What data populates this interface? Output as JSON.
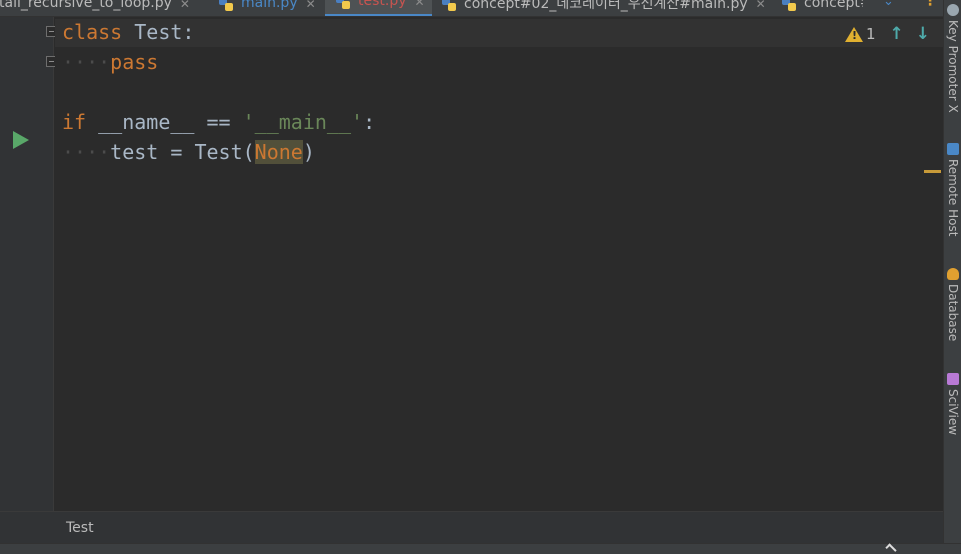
{
  "tabs": [
    {
      "label": "tail_recursive_to_loop.py",
      "color": "#bbbbbb",
      "active": false,
      "closable": true
    },
    {
      "label": "main.py",
      "color": "#4a88c7",
      "active": false,
      "closable": true
    },
    {
      "label": "test.py",
      "color": "#c75450",
      "active": true,
      "closable": true
    },
    {
      "label": "concept#02_데코레이터_우선계산#main.py",
      "color": "#bbbbbb",
      "active": false,
      "closable": true
    },
    {
      "label": "concept#",
      "color": "#bbbbbb",
      "active": false,
      "closable": false
    }
  ],
  "code": {
    "line1": {
      "kw": "class",
      "rest": " Test:"
    },
    "line2": {
      "indent": "····",
      "kw": "pass"
    },
    "line4": {
      "kw": "if",
      "mid": " __name__ == ",
      "str": "'__main__'",
      "end": ":"
    },
    "line5": {
      "indent": "····",
      "pre": "test = Test(",
      "none": "None",
      "post": ")"
    }
  },
  "inspection": {
    "warning_count": "1",
    "up_arrow": "↑",
    "down_arrow": "↓"
  },
  "right_tools": [
    {
      "label": "Key Promoter X",
      "icon": "key-promoter-icon",
      "color": "#9aa7b0"
    },
    {
      "label": "Remote Host",
      "icon": "remote-host-icon",
      "color": "#4a88c7"
    },
    {
      "label": "Database",
      "icon": "database-icon",
      "color": "#e0a030"
    },
    {
      "label": "SciView",
      "icon": "sciview-icon",
      "color": "#b97ad6"
    }
  ],
  "breadcrumb": {
    "item": "Test"
  },
  "colors": {
    "run": "#59a869",
    "warning": "#e0b030",
    "accent": "#4a88c7"
  }
}
